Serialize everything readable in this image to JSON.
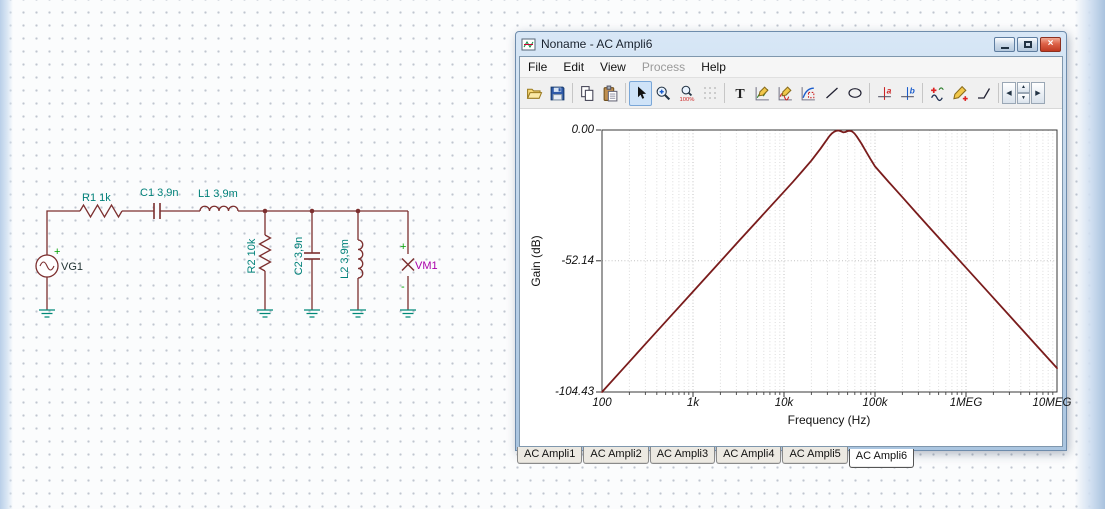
{
  "desktop": {
    "schematic": {
      "source_label": "VG1",
      "r1_label": "R1 1k",
      "c1_label": "C1 3,9n",
      "l1_label": "L1 3,9m",
      "r2_label": "R2 10k",
      "c2_label": "C2 3,9n",
      "l2_label": "L2 3,9m",
      "meter_label": "VM1",
      "plus_sign": "+",
      "minus_sign": "-",
      "colors": {
        "wire": "#7c2f2f",
        "value_label": "#008079",
        "source_label": "#223333",
        "meter_label": "#aa00aa",
        "ground": "#008878",
        "plus": "#00a000"
      }
    }
  },
  "window": {
    "title": "Noname - AC Ampli6",
    "menu": {
      "items": [
        {
          "label": "File",
          "enabled": true
        },
        {
          "label": "Edit",
          "enabled": true
        },
        {
          "label": "View",
          "enabled": true
        },
        {
          "label": "Process",
          "enabled": false
        },
        {
          "label": "Help",
          "enabled": true
        }
      ]
    },
    "toolbar": {
      "icons": [
        "open-folder",
        "save",
        "copy",
        "paste",
        "pointer",
        "zoom-in",
        "zoom-100",
        "grid",
        "text-tool",
        "pen-chart",
        "pen-wave",
        "chart-select",
        "line-tool",
        "ellipse-tool",
        "cursor-a",
        "cursor-b",
        "add-waveform",
        "probe-plus",
        "corner-line",
        "prev-curve",
        "curve-spinner",
        "next-curve"
      ],
      "active_tool": "pointer",
      "text_tool_label": "T",
      "zoom_level_label": "100%",
      "cursor_a_label": "a",
      "cursor_b_label": "b",
      "glyphs": {
        "prev": "◀",
        "next": "▶",
        "spin_up": "▲",
        "spin_down": "▼"
      }
    },
    "controls": {
      "close_glyph": "×"
    }
  },
  "chart_data": {
    "type": "line",
    "title": "",
    "xlabel": "Frequency (Hz)",
    "ylabel": "Gain (dB)",
    "x_scale": "log",
    "grid": true,
    "xlim": [
      100,
      10000000
    ],
    "ylim": [
      -104.43,
      0
    ],
    "xticks": [
      {
        "v": 100,
        "label": "100"
      },
      {
        "v": 1000,
        "label": "1k"
      },
      {
        "v": 10000,
        "label": "10k"
      },
      {
        "v": 100000,
        "label": "100k"
      },
      {
        "v": 1000000,
        "label": "1MEG"
      },
      {
        "v": 10000000,
        "label": "10MEG"
      }
    ],
    "yticks": [
      {
        "v": 0,
        "label": "0.00"
      },
      {
        "v": -52.14,
        "label": "-52.14"
      },
      {
        "v": -104.43,
        "label": "-104.43"
      }
    ],
    "series": [
      {
        "name": "Gain",
        "color": "#7a1c1c",
        "points": [
          [
            100,
            -104.43
          ],
          [
            178,
            -94.4
          ],
          [
            316,
            -84.4
          ],
          [
            562,
            -74.4
          ],
          [
            1000,
            -64.4
          ],
          [
            1780,
            -54.4
          ],
          [
            3160,
            -44.4
          ],
          [
            5620,
            -34.5
          ],
          [
            10000,
            -24.6
          ],
          [
            12600,
            -20.6
          ],
          [
            15800,
            -16.5
          ],
          [
            20000,
            -12.2
          ],
          [
            25100,
            -7.5
          ],
          [
            28200,
            -4.9
          ],
          [
            31600,
            -2.4
          ],
          [
            33500,
            -1.4
          ],
          [
            35500,
            -0.7
          ],
          [
            37600,
            -0.3
          ],
          [
            39800,
            -0.2
          ],
          [
            42200,
            -0.5
          ],
          [
            44700,
            -0.9
          ],
          [
            47300,
            -0.8
          ],
          [
            50100,
            -0.4
          ],
          [
            53100,
            -0.3
          ],
          [
            56200,
            -0.6
          ],
          [
            59600,
            -1.4
          ],
          [
            63100,
            -2.6
          ],
          [
            70800,
            -5.4
          ],
          [
            79400,
            -8.5
          ],
          [
            89100,
            -11.5
          ],
          [
            100000,
            -14.5
          ],
          [
            141000,
            -20.7
          ],
          [
            200000,
            -26.8
          ],
          [
            282000,
            -32.9
          ],
          [
            398000,
            -38.9
          ],
          [
            562000,
            -44.9
          ],
          [
            794000,
            -50.9
          ],
          [
            1000000,
            -54.9
          ],
          [
            1780000,
            -64.9
          ],
          [
            3160000,
            -74.9
          ],
          [
            5620000,
            -84.9
          ],
          [
            10000000,
            -94.9
          ]
        ]
      }
    ]
  },
  "footer_tabs": {
    "items": [
      "AC Ampli1",
      "AC Ampli2",
      "AC Ampli3",
      "AC Ampli4",
      "AC Ampli5",
      "AC Ampli6"
    ],
    "active": "AC Ampli6"
  }
}
